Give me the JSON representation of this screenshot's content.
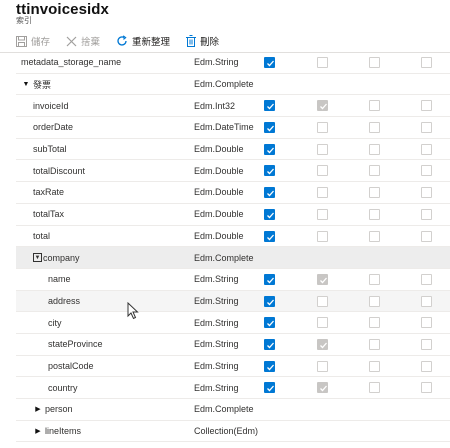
{
  "header": {
    "title": "ttinvoicesidx",
    "subtitle": "索引"
  },
  "toolbar": {
    "save_label": "儲存",
    "discard_label": "捨棄",
    "refresh_label": "重新整理",
    "delete_label": "刪除"
  },
  "rows": [
    {
      "name": "metadata_storage_name",
      "type": "Edm.String",
      "checks": [
        "on",
        "off",
        "off",
        "off"
      ]
    },
    {
      "name": "發票",
      "type": "Edm.Complete",
      "expander": "expanded",
      "checks": []
    },
    {
      "name": "invoiceId",
      "type": "Edm.Int32",
      "checks": [
        "on",
        "dis",
        "off",
        "off"
      ]
    },
    {
      "name": "orderDate",
      "type": "Edm.DateTime",
      "checks": [
        "on",
        "off",
        "off",
        "off"
      ]
    },
    {
      "name": "subTotal",
      "type": "Edm.Double",
      "checks": [
        "on",
        "off",
        "off",
        "off"
      ]
    },
    {
      "name": "totalDiscount",
      "type": "Edm.Double",
      "checks": [
        "on",
        "off",
        "off",
        "off"
      ]
    },
    {
      "name": "taxRate",
      "type": "Edm.Double",
      "checks": [
        "on",
        "off",
        "off",
        "off"
      ]
    },
    {
      "name": "totalTax",
      "type": "Edm.Double",
      "checks": [
        "on",
        "off",
        "off",
        "off"
      ]
    },
    {
      "name": "total",
      "type": "Edm.Double",
      "checks": [
        "on",
        "off",
        "off",
        "off"
      ]
    },
    {
      "name": "company",
      "type": "Edm.Complete",
      "expander": "expanded-box",
      "checks": []
    },
    {
      "name": "name",
      "type": "Edm.String",
      "checks": [
        "on",
        "dis",
        "off",
        "off"
      ]
    },
    {
      "name": "address",
      "type": "Edm.String",
      "checks": [
        "on",
        "off",
        "off",
        "off"
      ]
    },
    {
      "name": "city",
      "type": "Edm.String",
      "checks": [
        "on",
        "off",
        "off",
        "off"
      ]
    },
    {
      "name": "stateProvince",
      "type": "Edm.String",
      "checks": [
        "on",
        "dis",
        "off",
        "off"
      ]
    },
    {
      "name": "postalCode",
      "type": "Edm.String",
      "checks": [
        "on",
        "off",
        "off",
        "off"
      ]
    },
    {
      "name": "country",
      "type": "Edm.String",
      "checks": [
        "on",
        "dis",
        "off",
        "off"
      ]
    },
    {
      "name": "person",
      "type": "Edm.Complete",
      "expander": "collapsed",
      "checks": []
    },
    {
      "name": "lineItems",
      "type": "Collection(Edm)",
      "expander": "collapsed",
      "checks": []
    }
  ],
  "colors": {
    "accent": "#0078d4",
    "disabled_check": "#c8c6c4",
    "selected_row": "#ededed"
  }
}
